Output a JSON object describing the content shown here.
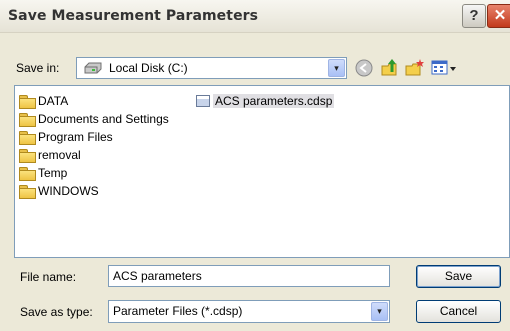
{
  "window": {
    "title": "Save Measurement Parameters",
    "help_glyph": "?",
    "close_glyph": "✕"
  },
  "save_in": {
    "label": "Save in:",
    "value": "Local Disk (C:)",
    "dropdown_glyph": "▾"
  },
  "toolbar": {
    "icons": [
      "back-icon",
      "up-folder-icon",
      "new-folder-icon",
      "view-menu-icon"
    ]
  },
  "file_list": {
    "folders": [
      "DATA",
      "Documents and Settings",
      "Program Files",
      "removal",
      "Temp",
      "WINDOWS"
    ],
    "files": [
      "ACS parameters.cdsp"
    ]
  },
  "file_name": {
    "label": "File name:",
    "value": "ACS parameters"
  },
  "save_as_type": {
    "label": "Save as type:",
    "value": "Parameter Files (*.cdsp)",
    "dropdown_glyph": "▾"
  },
  "buttons": {
    "save": "Save",
    "cancel": "Cancel"
  },
  "colors": {
    "accent": "#7f9db9",
    "face": "#ece9d8",
    "selection": "#e0dfe3"
  }
}
